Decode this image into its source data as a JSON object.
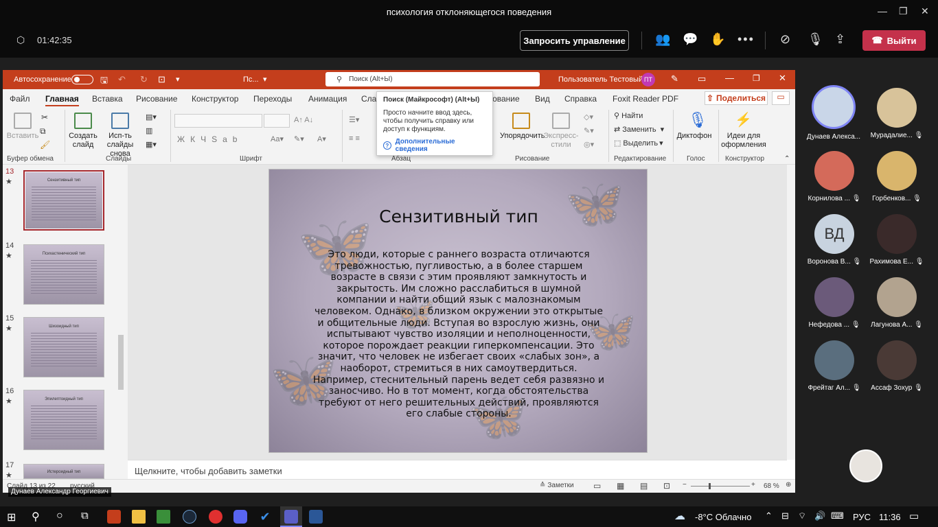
{
  "window": {
    "title": "психология отклоняющегося поведения"
  },
  "meeting": {
    "timer": "01:42:35",
    "request_control": "Запросить управление",
    "leave": "Выйти"
  },
  "ppt": {
    "autosave": "Автосохранение",
    "filename": "Пс...",
    "search_placeholder": "Поиск (Alt+Ы)",
    "user": "Пользователь Тестовый",
    "user_initials": "ПТ",
    "share": "Поделиться",
    "tabs": [
      "Файл",
      "Главная",
      "Вставка",
      "Рисование",
      "Конструктор",
      "Переходы",
      "Анимация",
      "Слайд",
      "Рецензирование",
      "Вид",
      "Справка",
      "Foxit Reader PDF"
    ],
    "ribbon": {
      "groups": {
        "clipboard": "Буфер обмена",
        "slides": "Слайды",
        "font": "Шрифт",
        "paragraph": "Абзац",
        "drawing": "Рисование",
        "editing": "Редактирование",
        "voice": "Голос",
        "designer": "Конструктор"
      },
      "paste": "Вставить",
      "new_slide": "Создать слайд",
      "reuse_slides": "Исп-ть слайды снова",
      "arrange": "Упорядочить",
      "quick_styles": "Экспресс-стили",
      "find": "Найти",
      "replace": "Заменить",
      "select": "Выделить",
      "dictate": "Диктофон",
      "design_ideas": "Идеи для оформления"
    },
    "tooltip": {
      "title": "Поиск (Майкрософт) (Alt+Ы)",
      "body": "Просто начните ввод здесь, чтобы получить справку или доступ к функциям.",
      "link": "Дополнительные сведения"
    },
    "thumbnails": [
      {
        "num": "13",
        "title": "Сензитивный тип"
      },
      {
        "num": "14",
        "title": "Психастенический тип"
      },
      {
        "num": "15",
        "title": "Шизоидный тип"
      },
      {
        "num": "16",
        "title": "Эпилептоидный тип"
      },
      {
        "num": "17",
        "title": "Истероидный тип"
      }
    ],
    "slide": {
      "title": "Сензитивный тип",
      "body": "Это люди, которые с раннего возраста отличаются тревожностью, пугливостью, а в более старшем возрасте в связи с этим проявляют замкнутость и закрытость. Им сложно расслабиться в шумной компании и найти общий язык с малознакомым человеком. Однако, в близком окружении это открытые и общительные люди. Вступая во взрослую жизнь, они испытывают чувство изоляции и неполноценности, которое порождает реакции гиперкомпенсации. Это значит, что человек не избегает своих «слабых зон», а наоборот, стремиться в них самоутвердиться. Например, стеснительный парень ведет себя развязно и заносчиво. Но в тот момент, когда обстоятельства требуют от него решительных действий, проявляются его слабые стороны."
    },
    "notes_placeholder": "Щелкните, чтобы добавить заметки",
    "status": {
      "slide": "Слайд 13 из 22",
      "lang": "русский",
      "notes": "Заметки",
      "zoom": "68 %"
    }
  },
  "presenter": "Дунаев Александр Георгиевич",
  "participants": [
    {
      "name": "Дунаев Алекса...",
      "color": "#c9d6e8"
    },
    {
      "name": "Мурадалие...",
      "color": "#d8c39a"
    },
    {
      "name": "Корнилова ...",
      "color": "#d46a5a"
    },
    {
      "name": "Горбенков...",
      "color": "#d9b56c"
    },
    {
      "name": "Воронова В...",
      "initials": "ВД",
      "color": "#c8d3df"
    },
    {
      "name": "Рахимова Е...",
      "color": "#3a2a2a"
    },
    {
      "name": "Нефедова ...",
      "color": "#6b5a7a"
    },
    {
      "name": "Лагунова А...",
      "color": "#b2a38f"
    },
    {
      "name": "Фрейтаг Ал...",
      "color": "#5a6e7e"
    },
    {
      "name": "Ассаф Зохур",
      "color": "#4a3a36"
    }
  ],
  "taskbar": {
    "weather": "-8°C  Облачно",
    "lang": "РУС",
    "time": "11:36"
  }
}
